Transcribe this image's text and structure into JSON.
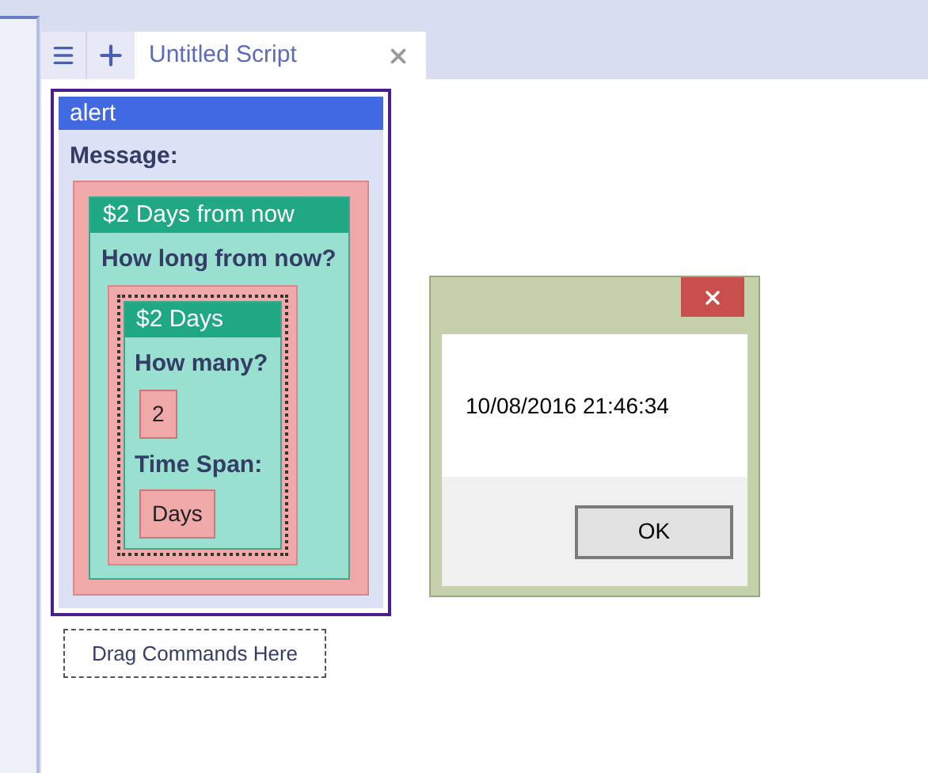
{
  "tabs": [
    {
      "label": "Untitled Script",
      "selected": true
    }
  ],
  "script": {
    "block": {
      "title": "alert",
      "param_label": "Message:",
      "value": {
        "title": "$2 Days from now",
        "param_label": "How long from now?",
        "value": {
          "title": "$2 Days",
          "params": [
            {
              "label": "How many?",
              "value": "2"
            },
            {
              "label": "Time Span:",
              "value": "Days"
            }
          ]
        }
      }
    },
    "drop_zone": "Drag Commands Here"
  },
  "dialog": {
    "message": "10/08/2016 21:46:34",
    "buttons": [
      "OK"
    ]
  }
}
